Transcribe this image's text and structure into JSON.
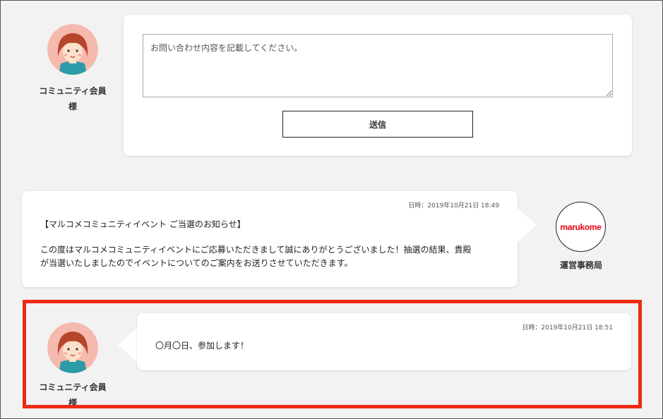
{
  "reply_form": {
    "member_name": "コミュニティ会員\n様",
    "textarea_placeholder": "お問い合わせ内容を記載してください。",
    "submit_label": "送信"
  },
  "messages": [
    {
      "sender": "運営事務局",
      "logo_text": "marukome",
      "timestamp": "日時：2019年10月21日 18:49",
      "title": "【マルコメコミュニティイベント ご当選のお知らせ】",
      "body_line1": "この度はマルコメコミュニティイベントにご応募いただきまして誠にありがとうございました！抽選の結果、貴殿",
      "body_line2": "が当選いたしましたのでイベントについてのご案内をお送りさせていただきます。"
    },
    {
      "sender": "コミュニティ会員\n様",
      "timestamp": "日時：2019年10月21日 18:51",
      "body": "〇月〇日、参加します！"
    }
  ],
  "colors": {
    "background": "#f2f2f2",
    "card": "#ffffff",
    "highlight": "#ee2a12",
    "logo_red": "#e60012"
  }
}
